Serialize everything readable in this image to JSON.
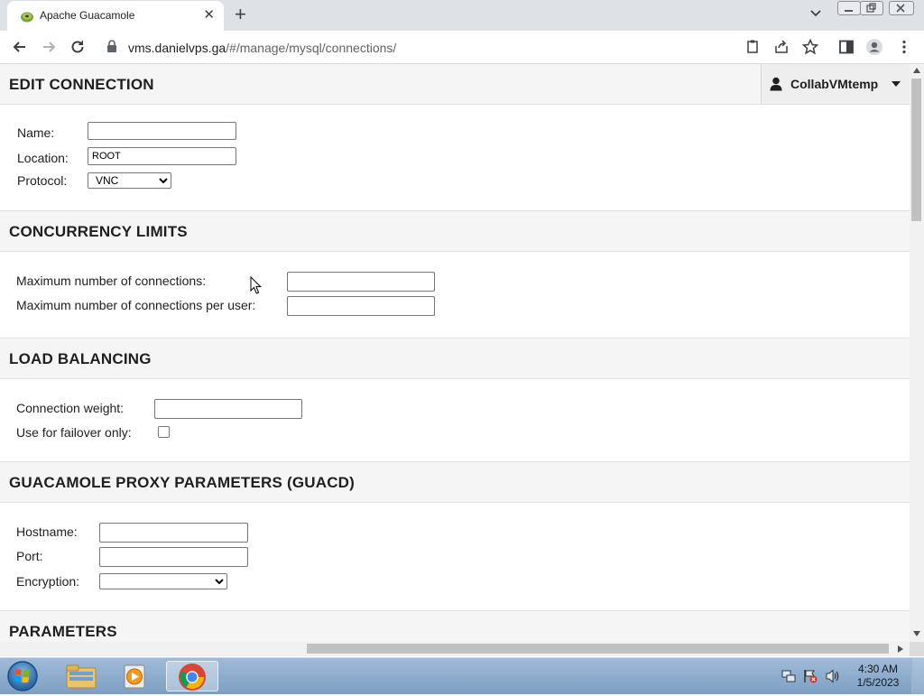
{
  "browser": {
    "tab_title": "Apache Guacamole",
    "url_host": "vms.danielvps.ga",
    "url_path": "/#/manage/mysql/connections/"
  },
  "page": {
    "title": "EDIT CONNECTION",
    "user": "CollabVMtemp",
    "general": {
      "name_label": "Name:",
      "name_value": "",
      "location_label": "Location:",
      "location_value": "ROOT",
      "protocol_label": "Protocol:",
      "protocol_value": "VNC"
    },
    "concurrency": {
      "title": "CONCURRENCY LIMITS",
      "max_connections_label": "Maximum number of connections:",
      "max_connections_value": "",
      "max_per_user_label": "Maximum number of connections per user:",
      "max_per_user_value": ""
    },
    "load_balancing": {
      "title": "LOAD BALANCING",
      "weight_label": "Connection weight:",
      "weight_value": "",
      "failover_label": "Use for failover only:",
      "failover_checked": false
    },
    "guacd": {
      "title": "GUACAMOLE PROXY PARAMETERS (GUACD)",
      "hostname_label": "Hostname:",
      "hostname_value": "",
      "port_label": "Port:",
      "port_value": "",
      "encryption_label": "Encryption:",
      "encryption_value": ""
    },
    "parameters": {
      "title": "PARAMETERS"
    }
  },
  "taskbar": {
    "time": "4:30 AM",
    "date": "1/5/2023"
  }
}
